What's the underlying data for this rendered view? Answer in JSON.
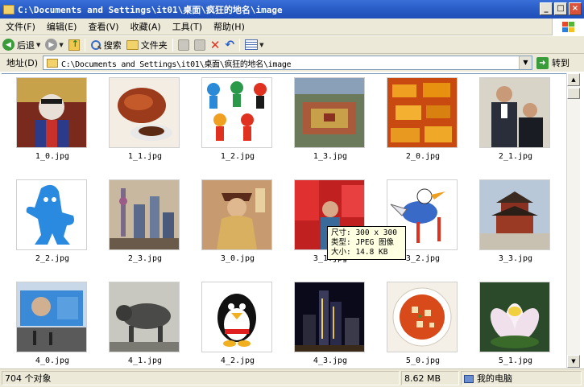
{
  "window": {
    "title": "C:\\Documents and Settings\\it01\\桌面\\疯狂的地名\\image",
    "controls": [
      "_",
      "□",
      "×"
    ]
  },
  "menu": [
    "文件(F)",
    "编辑(E)",
    "查看(V)",
    "收藏(A)",
    "工具(T)",
    "帮助(H)"
  ],
  "toolbar": {
    "back_label": "后退",
    "search_label": "搜索",
    "folders_label": "文件夹"
  },
  "address": {
    "label": "地址(D)",
    "value": "C:\\Documents and Settings\\it01\\桌面\\疯狂的地名\\image",
    "go_label": "转到"
  },
  "files": [
    {
      "name": "1_0.jpg",
      "icon": "opera-performer-thumb"
    },
    {
      "name": "1_1.jpg",
      "icon": "roast-duck-thumb"
    },
    {
      "name": "1_2.jpg",
      "icon": "mascots-thumb"
    },
    {
      "name": "1_3.jpg",
      "icon": "forbidden-city-thumb"
    },
    {
      "name": "2_0.jpg",
      "icon": "gold-bars-thumb"
    },
    {
      "name": "2_1.jpg",
      "icon": "two-men-thumb"
    },
    {
      "name": "2_2.jpg",
      "icon": "blue-mascot-thumb"
    },
    {
      "name": "2_3.jpg",
      "icon": "skyline-thumb"
    },
    {
      "name": "3_0.jpg",
      "icon": "qing-official-thumb"
    },
    {
      "name": "3_1.jpg",
      "icon": "red-flags-thumb"
    },
    {
      "name": "3_2.jpg",
      "icon": "crane-cartoon-thumb"
    },
    {
      "name": "3_3.jpg",
      "icon": "palace-thumb"
    },
    {
      "name": "4_0.jpg",
      "icon": "billboard-thumb"
    },
    {
      "name": "4_1.jpg",
      "icon": "bull-statue-thumb"
    },
    {
      "name": "4_2.jpg",
      "icon": "penguin-thumb"
    },
    {
      "name": "4_3.jpg",
      "icon": "night-city-thumb"
    },
    {
      "name": "5_0.jpg",
      "icon": "tofu-dish-thumb"
    },
    {
      "name": "5_1.jpg",
      "icon": "lotus-thumb"
    }
  ],
  "tooltip": {
    "size": "尺寸: 300 x 300",
    "type": "类型: JPEG 图像",
    "filesize": "大小: 14.8 KB"
  },
  "status": {
    "count": "704 个对象",
    "size": "8.62 MB",
    "location": "我的电脑"
  }
}
